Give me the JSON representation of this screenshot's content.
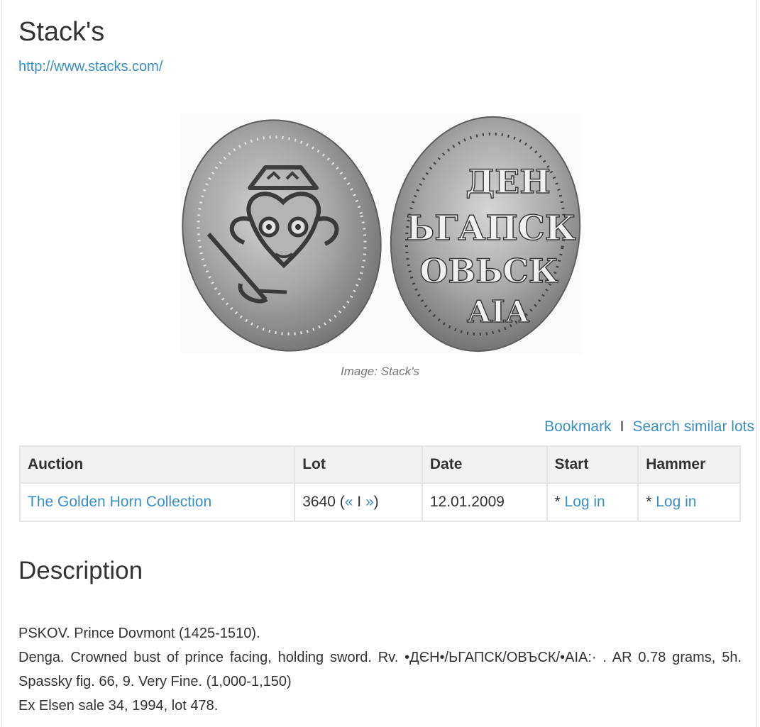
{
  "page": {
    "title": "Stack's",
    "link": "http://www.stacks.com/"
  },
  "image": {
    "caption": "Image: Stack's",
    "obverse_legend": "",
    "reverse_legend": "ДЕН ЬГАПСК ОВЬСК АIА"
  },
  "actions": {
    "bookmark": "Bookmark",
    "separator": "I",
    "search_similar": "Search similar lots"
  },
  "table": {
    "headers": [
      "Auction",
      "Lot",
      "Date",
      "Start",
      "Hammer"
    ],
    "row": {
      "auction": "The Golden Horn Collection",
      "lot_number": "3640",
      "lot_open": " (",
      "prev": "«",
      "nav_sep": " I ",
      "next": "»",
      "lot_close": ")",
      "date": "12.01.2009",
      "start_prefix": "* ",
      "start_link": "Log in",
      "hammer_prefix": "* ",
      "hammer_link": "Log in"
    }
  },
  "description": {
    "heading": "Description",
    "lines": [
      "PSKOV. Prince Dovmont (1425-1510).",
      "Denga. Crowned bust of prince facing, holding sword. Rv. •ДЄН•/ЬГАПСК/ОВЪСК/•AIA:· . AR 0.78 grams, 5h. Spassky fig. 66, 9. Very Fine. (1,000-1,150)",
      "Ex Elsen sale 34, 1994, lot 478."
    ]
  },
  "colors": {
    "link": "#3a8fc4",
    "text": "#333333",
    "table_header_bg": "#f2f2f2",
    "border": "#e6e6e6",
    "coin_silver": "#9a9a9a"
  }
}
